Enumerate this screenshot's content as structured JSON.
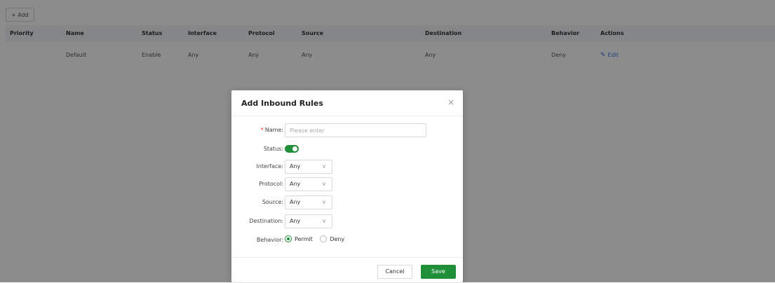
{
  "toolbar": {
    "add_label": "+ Add"
  },
  "table": {
    "columns": [
      "Priority",
      "Name",
      "Status",
      "Interface",
      "Protocol",
      "Source",
      "Destination",
      "Behavior",
      "Actions"
    ],
    "rows": [
      {
        "priority": "",
        "name": "Default",
        "status": "Enable",
        "interface": "Any",
        "protocol": "Any",
        "source": "Any",
        "destination": "Any",
        "behavior": "Deny",
        "action": "Edit"
      }
    ]
  },
  "modal": {
    "title": "Add Inbound Rules",
    "close_icon": "×",
    "name_label": "Name:",
    "name_required": "*",
    "name_placeholder": "Please enter",
    "name_value": "",
    "status_label": "Status:",
    "status_on": true,
    "interface_label": "Interface:",
    "interface_value": "Any",
    "protocol_label": "Protocol:",
    "protocol_value": "Any",
    "source_label": "Source:",
    "source_value": "Any",
    "destination_label": "Destination:",
    "destination_value": "Any",
    "behavior_label": "Behavior:",
    "behavior_options": [
      "Permit",
      "Deny"
    ],
    "behavior_selected": "Permit",
    "cancel_label": "Cancel",
    "save_label": "Save"
  },
  "colors": {
    "primary_green": "#1f8f3a",
    "link_blue": "#3b6ee0",
    "overlay": "rgba(0,0,0,0.45)"
  },
  "icons": {
    "edit": "edit-icon",
    "close": "close-icon",
    "chevron": "chevron-down-icon"
  }
}
